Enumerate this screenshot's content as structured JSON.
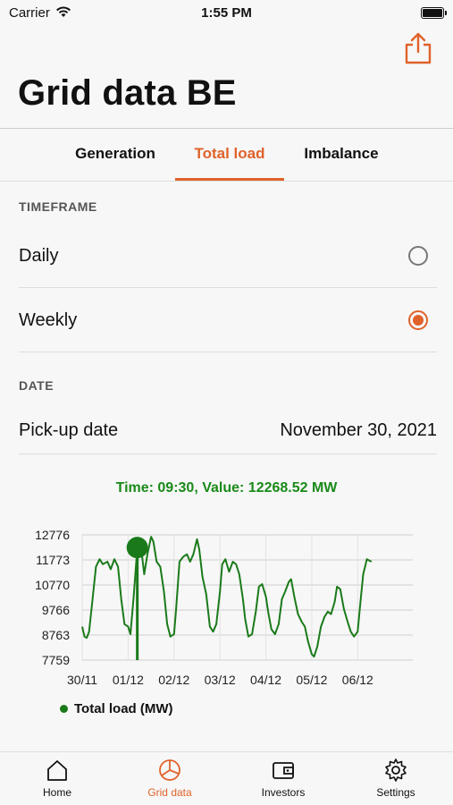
{
  "status_bar": {
    "carrier": "Carrier",
    "time": "1:55 PM"
  },
  "header": {
    "title": "Grid data BE"
  },
  "segments": [
    {
      "label": "Generation",
      "active": false
    },
    {
      "label": "Total load",
      "active": true
    },
    {
      "label": "Imbalance",
      "active": false
    }
  ],
  "timeframe": {
    "section_label": "TIMEFRAME",
    "options": [
      {
        "label": "Daily",
        "selected": false
      },
      {
        "label": "Weekly",
        "selected": true
      }
    ]
  },
  "date_section": {
    "section_label": "DATE",
    "label": "Pick-up date",
    "value": "November 30, 2021"
  },
  "chart_caption": "Time: 09:30, Value: 12268.52 MW",
  "chart_data": {
    "type": "line",
    "x_tick_labels": [
      "30/11",
      "01/12",
      "02/12",
      "03/12",
      "04/12",
      "05/12",
      "06/12"
    ],
    "y_tick_labels": [
      "12776",
      "11773",
      "10770",
      "9766",
      "8763",
      "7759"
    ],
    "ylim": [
      7759,
      12776
    ],
    "xlim": [
      0,
      7.2
    ],
    "series": [
      {
        "name": "Total load (MW)",
        "color": "#1a7a1a",
        "x": [
          0,
          0.05,
          0.1,
          0.15,
          0.22,
          0.3,
          0.38,
          0.45,
          0.55,
          0.62,
          0.7,
          0.78,
          0.85,
          0.92,
          1.0,
          1.05,
          1.12,
          1.2,
          1.28,
          1.35,
          1.42,
          1.5,
          1.55,
          1.62,
          1.7,
          1.78,
          1.85,
          1.92,
          2.0,
          2.05,
          2.12,
          2.2,
          2.28,
          2.35,
          2.42,
          2.5,
          2.55,
          2.62,
          2.7,
          2.78,
          2.85,
          2.92,
          3.0,
          3.05,
          3.12,
          3.2,
          3.28,
          3.35,
          3.42,
          3.5,
          3.55,
          3.62,
          3.7,
          3.78,
          3.85,
          3.92,
          4.0,
          4.05,
          4.12,
          4.2,
          4.28,
          4.35,
          4.42,
          4.5,
          4.55,
          4.62,
          4.7,
          4.78,
          4.85,
          4.92,
          5.0,
          5.05,
          5.12,
          5.2,
          5.28,
          5.35,
          5.42,
          5.5,
          5.55,
          5.62,
          5.7,
          5.78,
          5.85,
          5.92,
          6.0,
          6.05,
          6.12,
          6.2,
          6.3
        ],
        "y": [
          9100,
          8700,
          8650,
          8900,
          10100,
          11500,
          11800,
          11600,
          11700,
          11400,
          11800,
          11500,
          10200,
          9200,
          9100,
          8800,
          10300,
          12268,
          12300,
          11200,
          12000,
          12700,
          12500,
          11700,
          11500,
          10500,
          9200,
          8700,
          8800,
          9900,
          11700,
          11900,
          12000,
          11700,
          12000,
          12600,
          12200,
          11100,
          10400,
          9100,
          8900,
          9200,
          10500,
          11600,
          11800,
          11300,
          11700,
          11600,
          11200,
          10200,
          9400,
          8700,
          8800,
          9700,
          10700,
          10800,
          10300,
          9700,
          9000,
          8800,
          9200,
          10200,
          10500,
          10900,
          11000,
          10300,
          9600,
          9300,
          9100,
          8500,
          8000,
          7900,
          8300,
          9100,
          9500,
          9700,
          9600,
          10100,
          10700,
          10600,
          9800,
          9300,
          8900,
          8700,
          8900,
          9900,
          11200,
          11800,
          11700
        ]
      }
    ],
    "marker": {
      "x": 1.2,
      "y": 12268
    },
    "legend": "Total load (MW)",
    "grid": true
  },
  "tabbar": [
    {
      "label": "Home",
      "icon": "home-icon",
      "active": false
    },
    {
      "label": "Grid data",
      "icon": "pie-chart-icon",
      "active": true
    },
    {
      "label": "Investors",
      "icon": "wallet-icon",
      "active": false
    },
    {
      "label": "Settings",
      "icon": "gear-icon",
      "active": false
    }
  ],
  "colors": {
    "accent": "#e0622a",
    "series": "#1a7a1a",
    "caption": "#1a8a1a"
  }
}
